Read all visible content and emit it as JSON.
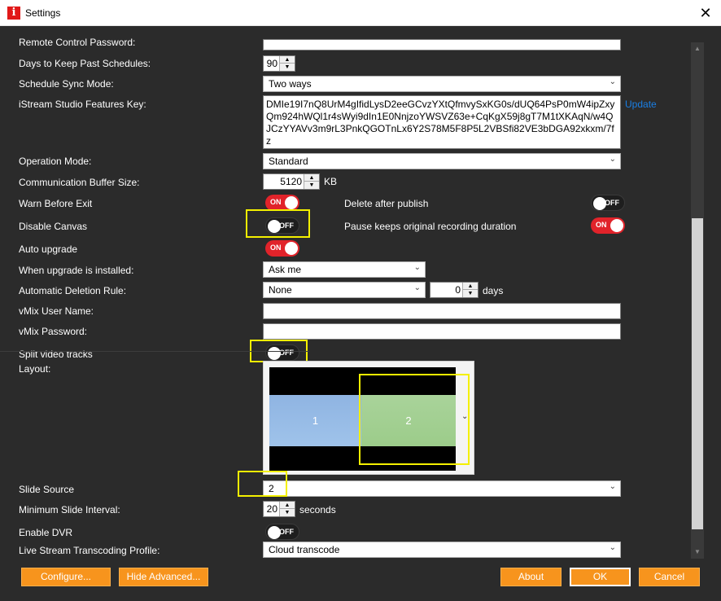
{
  "window": {
    "title": "Settings",
    "close_glyph": "✕",
    "app_icon_letter": "i"
  },
  "labels": {
    "remote_control_password": "Remote Control Password:",
    "days_to_keep": "Days to Keep Past Schedules:",
    "schedule_sync_mode": "Schedule Sync Mode:",
    "features_key": "iStream Studio Features Key:",
    "operation_mode": "Operation Mode:",
    "comm_buffer": "Communication Buffer Size:",
    "warn_before_exit": "Warn Before Exit",
    "delete_after_publish": "Delete after publish",
    "disable_canvas": "Disable Canvas",
    "pause_keeps": "Pause keeps original recording duration",
    "auto_upgrade": "Auto upgrade",
    "when_upgrade": "When upgrade is installed:",
    "auto_deletion": "Automatic Deletion Rule:",
    "vmix_user": "vMix User Name:",
    "vmix_password": "vMix Password:",
    "split_video": "Split video tracks",
    "layout": "Layout:",
    "slide_source": "Slide Source",
    "min_slide_interval": "Minimum Slide Interval:",
    "enable_dvr": "Enable DVR",
    "transcoding_profile": "Live Stream Transcoding Profile:"
  },
  "values": {
    "remote_control_password": "",
    "days_to_keep": "90",
    "schedule_sync_mode": "Two ways",
    "features_key": "DMIe19I7nQ8UrM4gIfidLysD2eeGCvzYXtQfmvySxKG0s/dUQ64PsP0mW4ipZxyQm924hWQl1r4sWyi9dIn1E0NnjzoYWSVZ63e+CqKgX59j8gT7M1tXKAqN/w4QJCzYYAVv3m9rL3PnkQGOTnLx6Y2S78M5F8P5L2VBSfi82VE3bDGA92xkxm/7fz",
    "update_link": "Update",
    "operation_mode": "Standard",
    "comm_buffer": "5120",
    "comm_buffer_unit": "KB",
    "when_upgrade": "Ask me",
    "auto_deletion": "None",
    "auto_deletion_days": "0",
    "days_unit": "days",
    "vmix_user": "",
    "vmix_password": "",
    "slide_source": "2",
    "min_slide_interval": "20",
    "seconds_unit": "seconds",
    "transcoding_profile": "Cloud transcode"
  },
  "toggles": {
    "warn_before_exit": "ON",
    "delete_after_publish": "OFF",
    "disable_canvas": "OFF",
    "pause_keeps": "ON",
    "auto_upgrade": "ON",
    "split_video": "OFF",
    "enable_dvr": "OFF"
  },
  "layout_preview": {
    "pane1": "1",
    "pane2": "2"
  },
  "buttons": {
    "configure": "Configure...",
    "hide_advanced": "Hide Advanced...",
    "about": "About",
    "ok": "OK",
    "cancel": "Cancel"
  },
  "colors": {
    "accent_orange": "#f7941d",
    "toggle_on": "#e1232a",
    "highlight": "#f4f000",
    "link": "#1a7fe5",
    "background": "#2b2b2b"
  }
}
